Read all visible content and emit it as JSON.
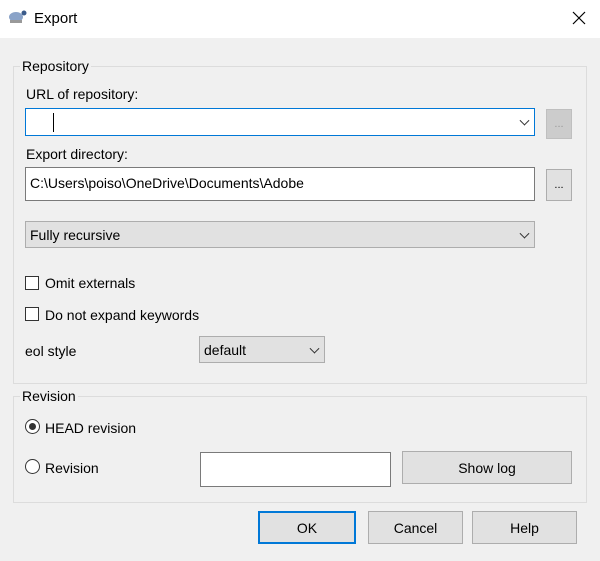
{
  "window": {
    "title": "Export",
    "app_icon": "tortoise-svn-icon",
    "close_icon": "close-icon"
  },
  "repository": {
    "legend": "Repository",
    "url_label": "URL of repository:",
    "url_value": "",
    "browse_label": "...",
    "export_dir_label": "Export directory:",
    "export_dir_value": "C:\\Users\\poiso\\OneDrive\\Documents\\Adobe",
    "export_browse_label": "...",
    "depth_selected": "Fully recursive",
    "omit_externals_label": "Omit externals",
    "omit_externals_checked": false,
    "no_expand_label": "Do not expand keywords",
    "no_expand_checked": false,
    "eol_label": "eol style",
    "eol_selected": "default"
  },
  "revision": {
    "legend": "Revision",
    "head_label": "HEAD revision",
    "head_selected": true,
    "revision_label": "Revision",
    "revision_selected": false,
    "revision_value": "",
    "show_log_label": "Show log"
  },
  "buttons": {
    "ok": "OK",
    "cancel": "Cancel",
    "help": "Help"
  },
  "colors": {
    "accent": "#0078d7"
  }
}
